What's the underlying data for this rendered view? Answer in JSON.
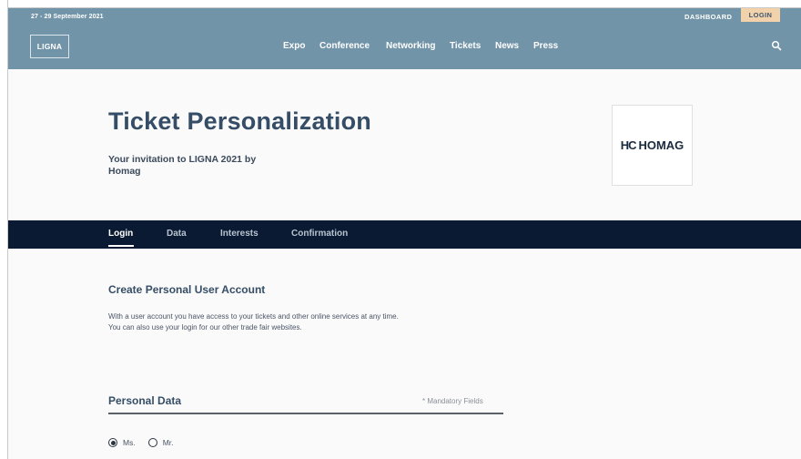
{
  "header": {
    "date": "27 - 29 September 2021",
    "dashboard_label": "DASHBOARD",
    "login_label": "LOGIN",
    "logo_text": "LIGNA",
    "nav": [
      "Expo",
      "Conference",
      "Networking",
      "Tickets",
      "News",
      "Press"
    ],
    "search_icon": "search-icon"
  },
  "hero": {
    "title": "Ticket Personalization",
    "subtitle": "Your invitation to LIGNA 2021 by Homag",
    "partner_mark": "HC",
    "partner_name": "HOMAG"
  },
  "steps": [
    "Login",
    "Data",
    "Interests",
    "Confirmation"
  ],
  "active_step": "Login",
  "account": {
    "title": "Create Personal User Account",
    "intro_line1": "With a user account you have access to your tickets and other online services at any time.",
    "intro_line2": "You can also use your login for our other trade fair websites."
  },
  "personal": {
    "title": "Personal Data",
    "mandatory_note": "* Mandatory Fields",
    "salutation_options": [
      "Ms.",
      "Mr."
    ],
    "salutation_selected": "Ms."
  },
  "colors": {
    "header_bg": "#7294a8",
    "login_bg": "#f2d2ab",
    "steps_bg": "#0b1a33",
    "title_color": "#354d66"
  }
}
